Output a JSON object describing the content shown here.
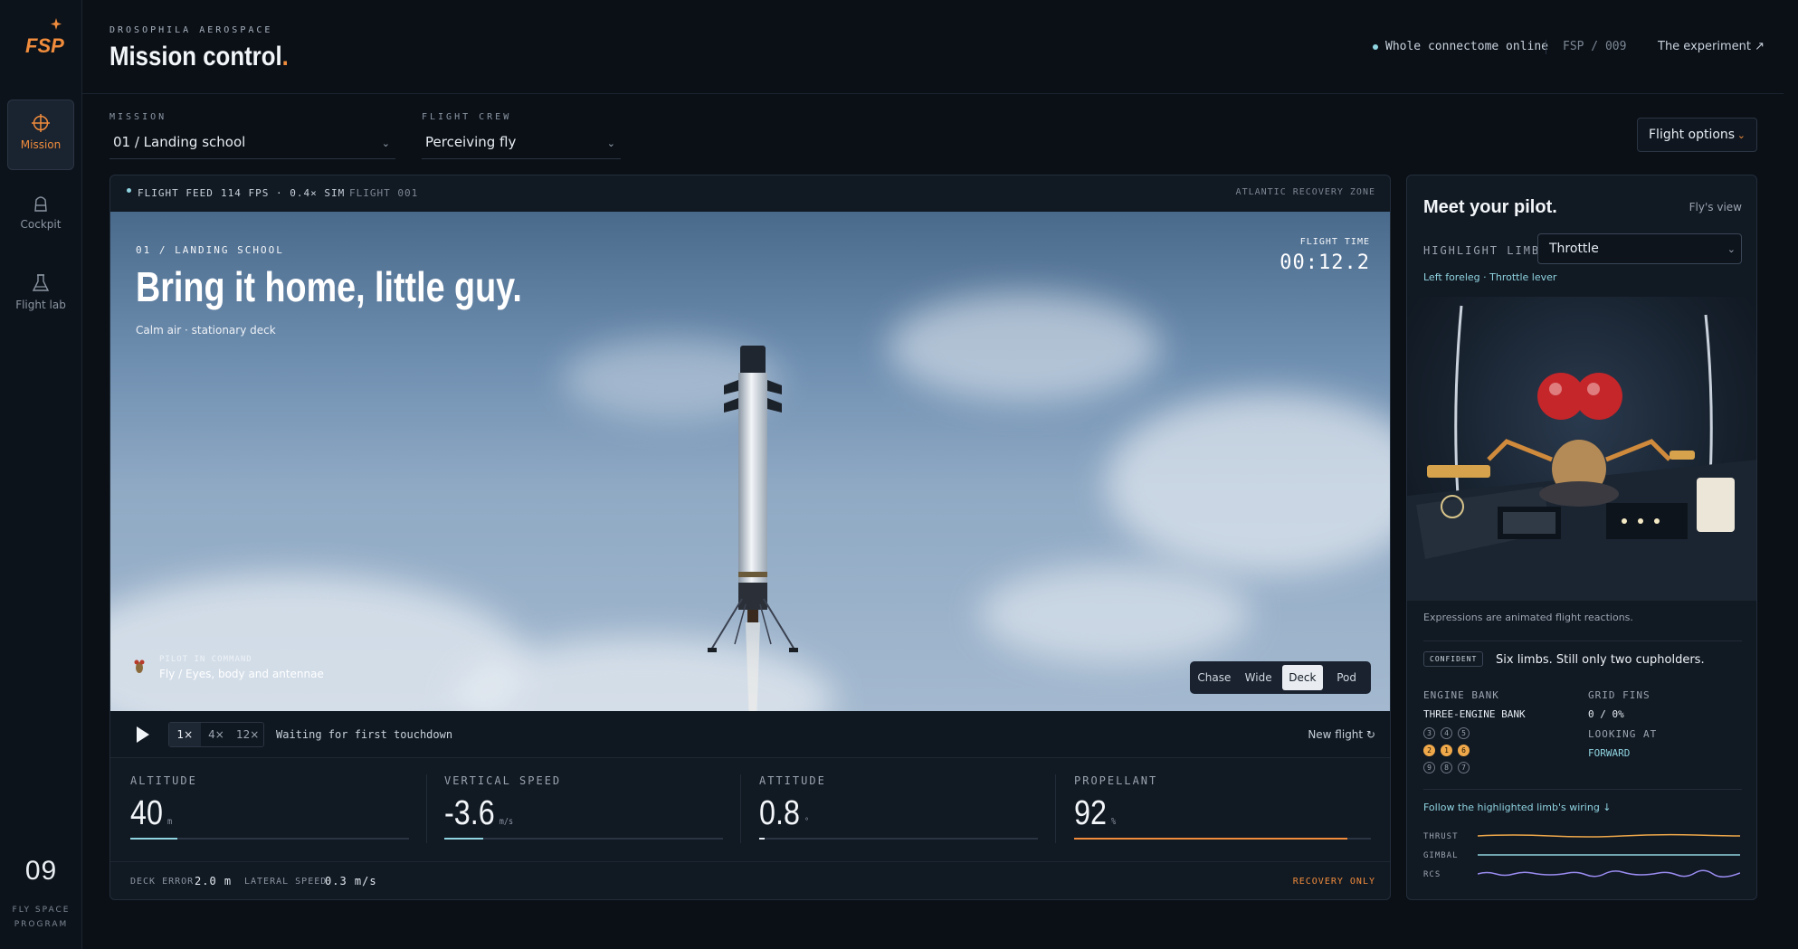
{
  "sidebar": {
    "logo_text": "FSP",
    "items": [
      {
        "label": "Mission",
        "icon": "crosshair-icon",
        "active": true
      },
      {
        "label": "Cockpit",
        "icon": "cockpit-icon",
        "active": false
      },
      {
        "label": "Flight lab",
        "icon": "flask-icon",
        "active": false
      }
    ],
    "program_number": "09",
    "program_line1": "FLY SPACE",
    "program_line2": "PROGRAM"
  },
  "header": {
    "eyebrow": "DROSOPHILA AEROSPACE",
    "title": "Mission control",
    "title_dot": ".",
    "status": "Whole connectome online",
    "code": "FSP / 009",
    "link": "The experiment ↗"
  },
  "controls": {
    "mission_label": "MISSION",
    "mission_value": "01 / Landing school",
    "crew_label": "FLIGHT CREW",
    "crew_value": "Perceiving fly",
    "options_label": "Flight options"
  },
  "feed": {
    "status": "FLIGHT FEED",
    "fps": "114 FPS · 0.4× SIM",
    "flight_id": "FLIGHT 001",
    "zone": "ATLANTIC RECOVERY ZONE",
    "eyebrow": "01 / LANDING SCHOOL",
    "headline": "Bring it home, little guy.",
    "conditions": "Calm air · stationary deck",
    "flight_time_label": "FLIGHT TIME",
    "flight_time": "00:12.2",
    "pilot_label": "PILOT IN COMMAND",
    "pilot_name": "Fly / Eyes, body and antennae",
    "cameras": [
      "Chase",
      "Wide",
      "Deck",
      "Pod"
    ],
    "active_camera": "Deck",
    "speeds": [
      "1×",
      "4×",
      "12×"
    ],
    "active_speed": "1×",
    "status_msg": "Waiting for first touchdown",
    "new_flight": "New flight ↻"
  },
  "metrics": [
    {
      "label": "ALTITUDE",
      "value": "40",
      "unit": "m",
      "fill": 0.17,
      "color": "#8fd4e0"
    },
    {
      "label": "VERTICAL SPEED",
      "value": "-3.6",
      "unit": "m/s",
      "fill": 0.14,
      "color": "#8fd4e0"
    },
    {
      "label": "ATTITUDE",
      "value": "0.8",
      "unit": "°",
      "fill": 0.02,
      "color": "#e6ecf2"
    },
    {
      "label": "PROPELLANT",
      "value": "92",
      "unit": "%",
      "fill": 0.92,
      "color": "#f08c3c"
    }
  ],
  "footer": {
    "deck_error_label": "DECK ERROR",
    "deck_error": "2.0 m",
    "lateral_label": "LATERAL SPEED",
    "lateral": "0.3 m/s",
    "mode": "RECOVERY ONLY"
  },
  "pilot_panel": {
    "title": "Meet your pilot.",
    "view_link": "Fly's view",
    "highlight_label": "HIGHLIGHT LIMB",
    "highlight_value": "Throttle",
    "limb_caption": "Left foreleg · Throttle lever",
    "expressions_note": "Expressions are animated flight reactions.",
    "badge": "CONFIDENT",
    "quip": "Six limbs. Still only two cupholders.",
    "engine_bank_label": "ENGINE BANK",
    "engine_bank_value": "THREE-ENGINE BANK",
    "engines": [
      [
        "3",
        "4",
        "5"
      ],
      [
        "2",
        "1",
        "6"
      ],
      [
        "9",
        "8",
        "7"
      ]
    ],
    "active_engines": [
      "2",
      "1",
      "6"
    ],
    "grid_fins_label": "GRID FINS",
    "grid_fins_value": "0 / 0%",
    "looking_label": "LOOKING AT",
    "looking_value": "FORWARD",
    "follow_link": "Follow the highlighted limb's wiring ↓",
    "telemetry": [
      {
        "label": "THRUST",
        "color": "#f0a94a"
      },
      {
        "label": "GIMBAL",
        "color": "#8fd4e0"
      },
      {
        "label": "RCS",
        "color": "#9a8cf0"
      }
    ]
  }
}
